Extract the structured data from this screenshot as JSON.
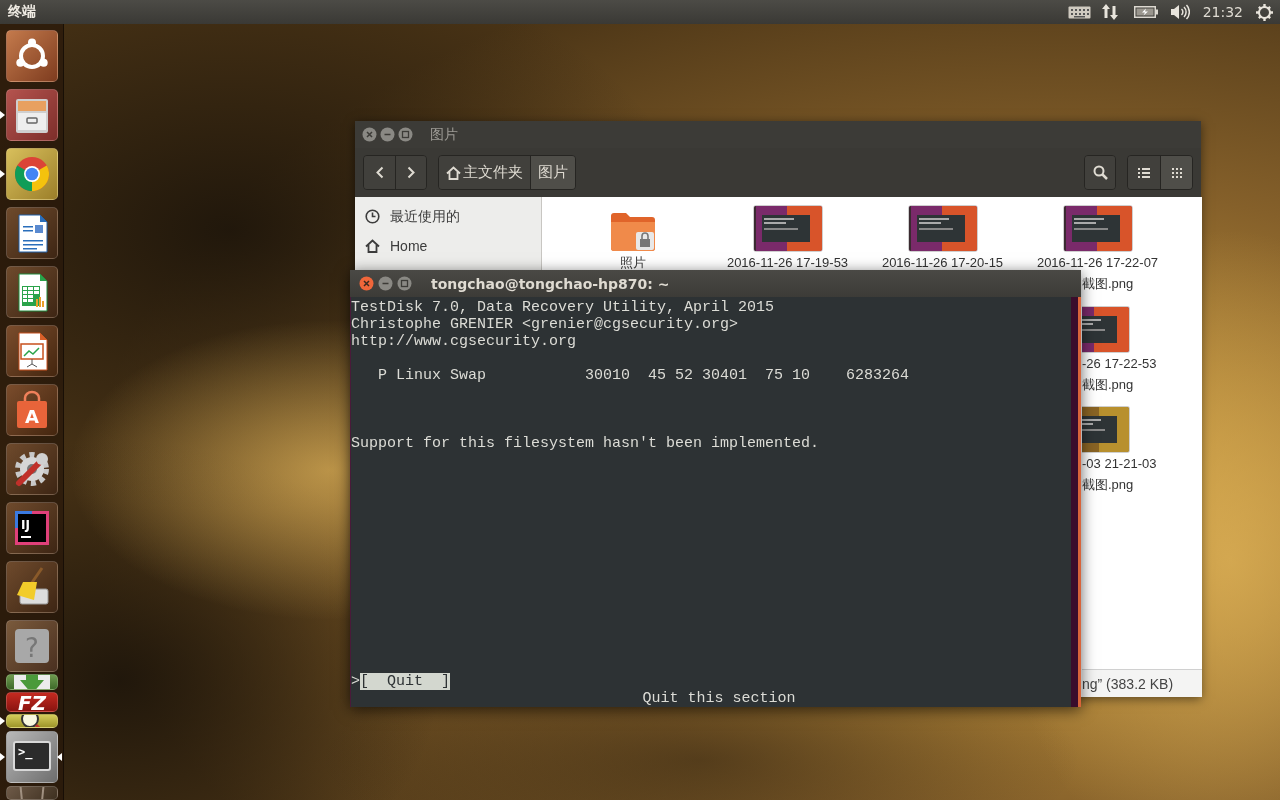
{
  "top_panel": {
    "app_title": "终端",
    "clock": "21:32"
  },
  "launcher": [
    {
      "kind": "dash",
      "running": false,
      "focused": false
    },
    {
      "kind": "files",
      "running": true,
      "focused": false
    },
    {
      "kind": "browser",
      "running": true,
      "focused": false
    },
    {
      "kind": "writer",
      "running": false,
      "focused": false
    },
    {
      "kind": "calc",
      "running": false,
      "focused": false
    },
    {
      "kind": "impress",
      "running": false,
      "focused": false
    },
    {
      "kind": "software",
      "glyph": "A",
      "running": false,
      "focused": false
    },
    {
      "kind": "settings",
      "running": false,
      "focused": false
    },
    {
      "kind": "ide",
      "glyph": "IJ",
      "running": false,
      "focused": false
    },
    {
      "kind": "cleaner",
      "running": false,
      "focused": false
    },
    {
      "kind": "help",
      "glyph": "?",
      "running": false,
      "focused": false
    },
    {
      "kind": "download",
      "running": false,
      "focused": false
    },
    {
      "kind": "ftp",
      "glyph": "FZ",
      "running": false,
      "focused": false
    },
    {
      "kind": "screenshot",
      "running": true,
      "focused": false
    },
    {
      "kind": "terminal",
      "glyph": ">_",
      "running": true,
      "focused": true
    },
    {
      "kind": "trash",
      "running": false,
      "focused": false
    }
  ],
  "files_window": {
    "title": "图片",
    "focused": false,
    "path": [
      {
        "label": "主文件夹",
        "home": true,
        "selected": false
      },
      {
        "label": "图片",
        "home": false,
        "selected": true
      }
    ],
    "views": [
      {
        "kind": "list",
        "selected": false
      },
      {
        "kind": "grid",
        "selected": true
      }
    ],
    "sidebar": [
      {
        "kind": "recent",
        "label": "最近使用的"
      },
      {
        "kind": "home",
        "label": "Home"
      }
    ],
    "items": [
      {
        "kind": "folder",
        "name": "照片"
      },
      {
        "name": "2016-11-26 17-19-53"
      },
      {
        "name": "2016-11-26 17-20-15"
      },
      {
        "name": "2016-11-26 17-22-07",
        "name_tail": "截图.png"
      }
    ],
    "partial_items": [
      {
        "name": "-26 17-22-53",
        "name_tail": "截图.png"
      },
      {
        "name": "-03 21-21-03",
        "name_tail": "截图.png"
      }
    ],
    "status": "ng” (383.2 KB)"
  },
  "terminal_window": {
    "title": "tongchao@tongchao-hp870: ~",
    "focused": true,
    "header": [
      "TestDisk 7.0, Data Recovery Utility, April 2015",
      "Christophe GRENIER <grenier@cgsecurity.org>",
      "http://www.cgsecurity.org"
    ],
    "partition": "   P Linux Swap           30010  45 52 30401  75 10    6283264",
    "message": "Support for this filesystem hasn't been implemented.",
    "menu": {
      "prefix": ">",
      "label": "[  Quit  ]",
      "selected": true
    },
    "hint": "Quit this section"
  }
}
